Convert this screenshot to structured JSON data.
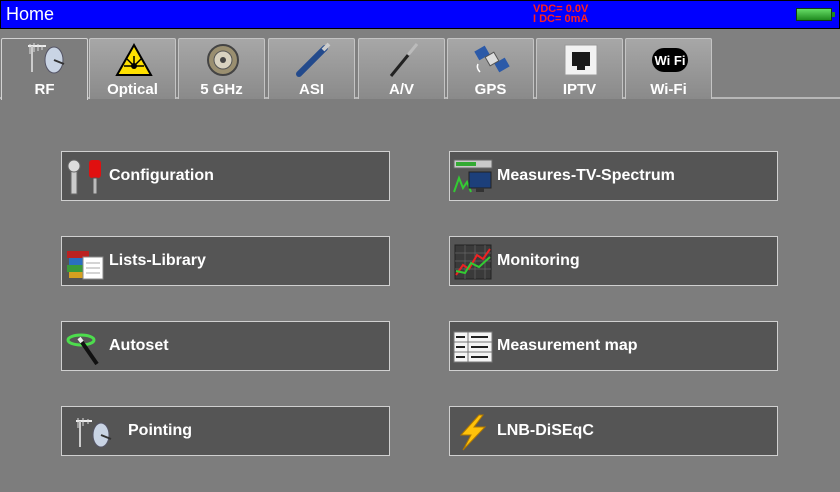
{
  "header": {
    "title": "Home",
    "vdc": "VDC= 0.0V",
    "idc": "I DC=  0mA"
  },
  "tabs": [
    {
      "label": "RF",
      "icon": "antenna-dish-icon",
      "active": true
    },
    {
      "label": "Optical",
      "icon": "laser-warning-icon",
      "active": false
    },
    {
      "label": "5 GHz",
      "icon": "connector-icon",
      "active": false
    },
    {
      "label": "ASI",
      "icon": "cable-icon",
      "active": false
    },
    {
      "label": "A/V",
      "icon": "av-plug-icon",
      "active": false
    },
    {
      "label": "GPS",
      "icon": "satellite-icon",
      "active": false
    },
    {
      "label": "IPTV",
      "icon": "ethernet-port-icon",
      "active": false
    },
    {
      "label": "Wi-Fi",
      "icon": "wifi-icon",
      "active": false
    }
  ],
  "menu": {
    "left": [
      {
        "label": "Configuration",
        "icon": "tools-icon"
      },
      {
        "label": "Lists-Library",
        "icon": "books-icon"
      },
      {
        "label": "Autoset",
        "icon": "magic-wand-icon"
      },
      {
        "label": "Pointing",
        "icon": "antenna-dish-icon"
      }
    ],
    "right": [
      {
        "label": "Measures-TV-Spectrum",
        "icon": "tv-spectrum-icon"
      },
      {
        "label": "Monitoring",
        "icon": "chart-icon"
      },
      {
        "label": "Measurement map",
        "icon": "table-icon"
      },
      {
        "label": "LNB-DiSEqC",
        "icon": "lightning-icon"
      }
    ]
  },
  "colors": {
    "titlebar": "#0000ff",
    "background": "#7d7d7d",
    "button": "#555555",
    "status_text": "#ff2020",
    "battery": "#3cb43c"
  }
}
